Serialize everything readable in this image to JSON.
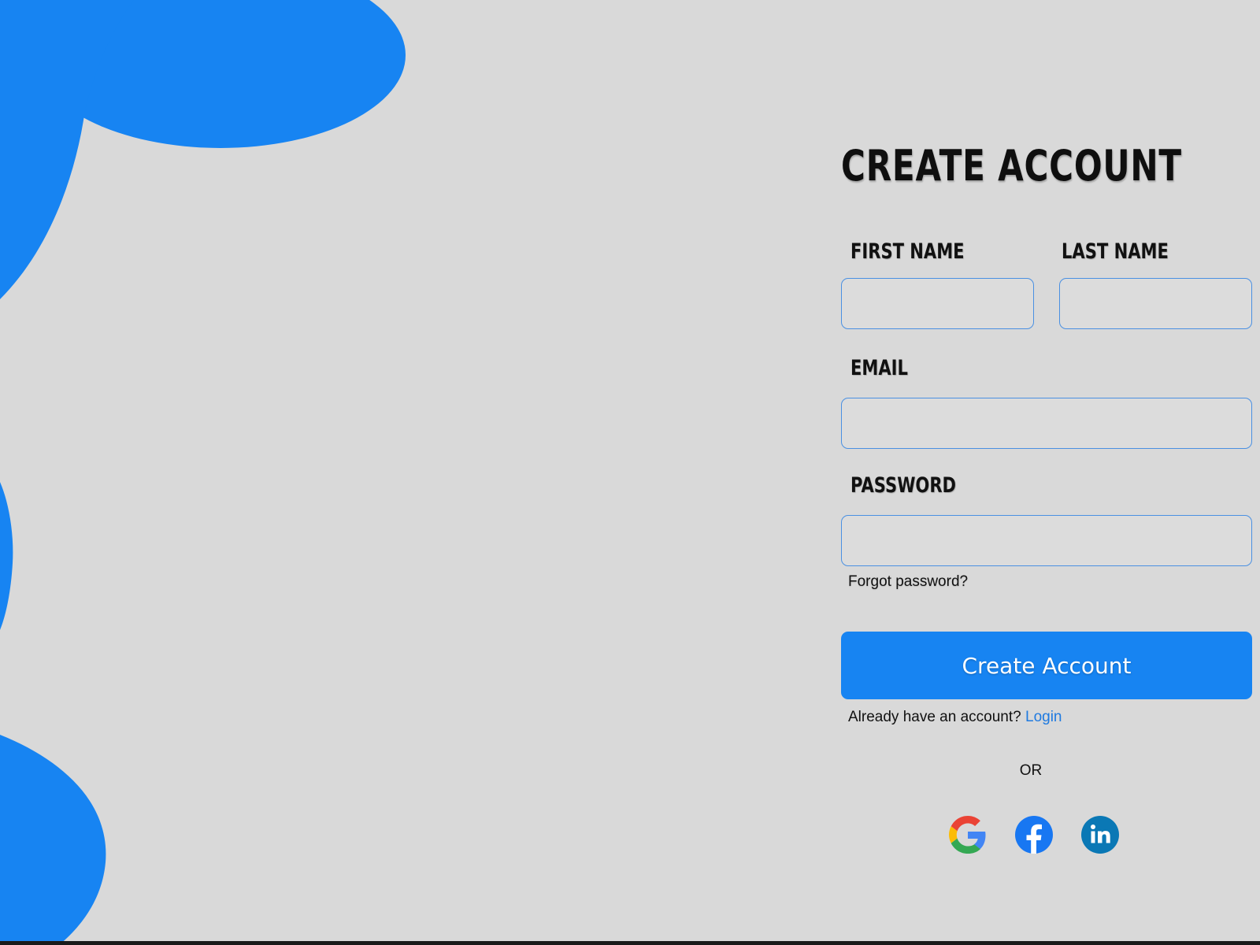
{
  "form": {
    "title": "CREATE ACCOUNT",
    "first_name_label": "FIRST NAME",
    "first_name_value": "",
    "last_name_label": "LAST NAME",
    "last_name_value": "",
    "email_label": "EMAIL",
    "email_value": "",
    "password_label": "PASSWORD",
    "password_value": "",
    "forgot_password": "Forgot password?",
    "submit_label": "Create Account",
    "already_text": "Already have an account?",
    "login_link": "Login",
    "or_text": "OR"
  },
  "social": [
    {
      "icon": "google-icon"
    },
    {
      "icon": "facebook-icon"
    },
    {
      "icon": "linkedin-icon"
    }
  ],
  "colors": {
    "background": "#d9d9d9",
    "accent": "#1784f2",
    "input_border": "#4a90e2",
    "link": "#1f7ae0",
    "text": "#111111"
  }
}
